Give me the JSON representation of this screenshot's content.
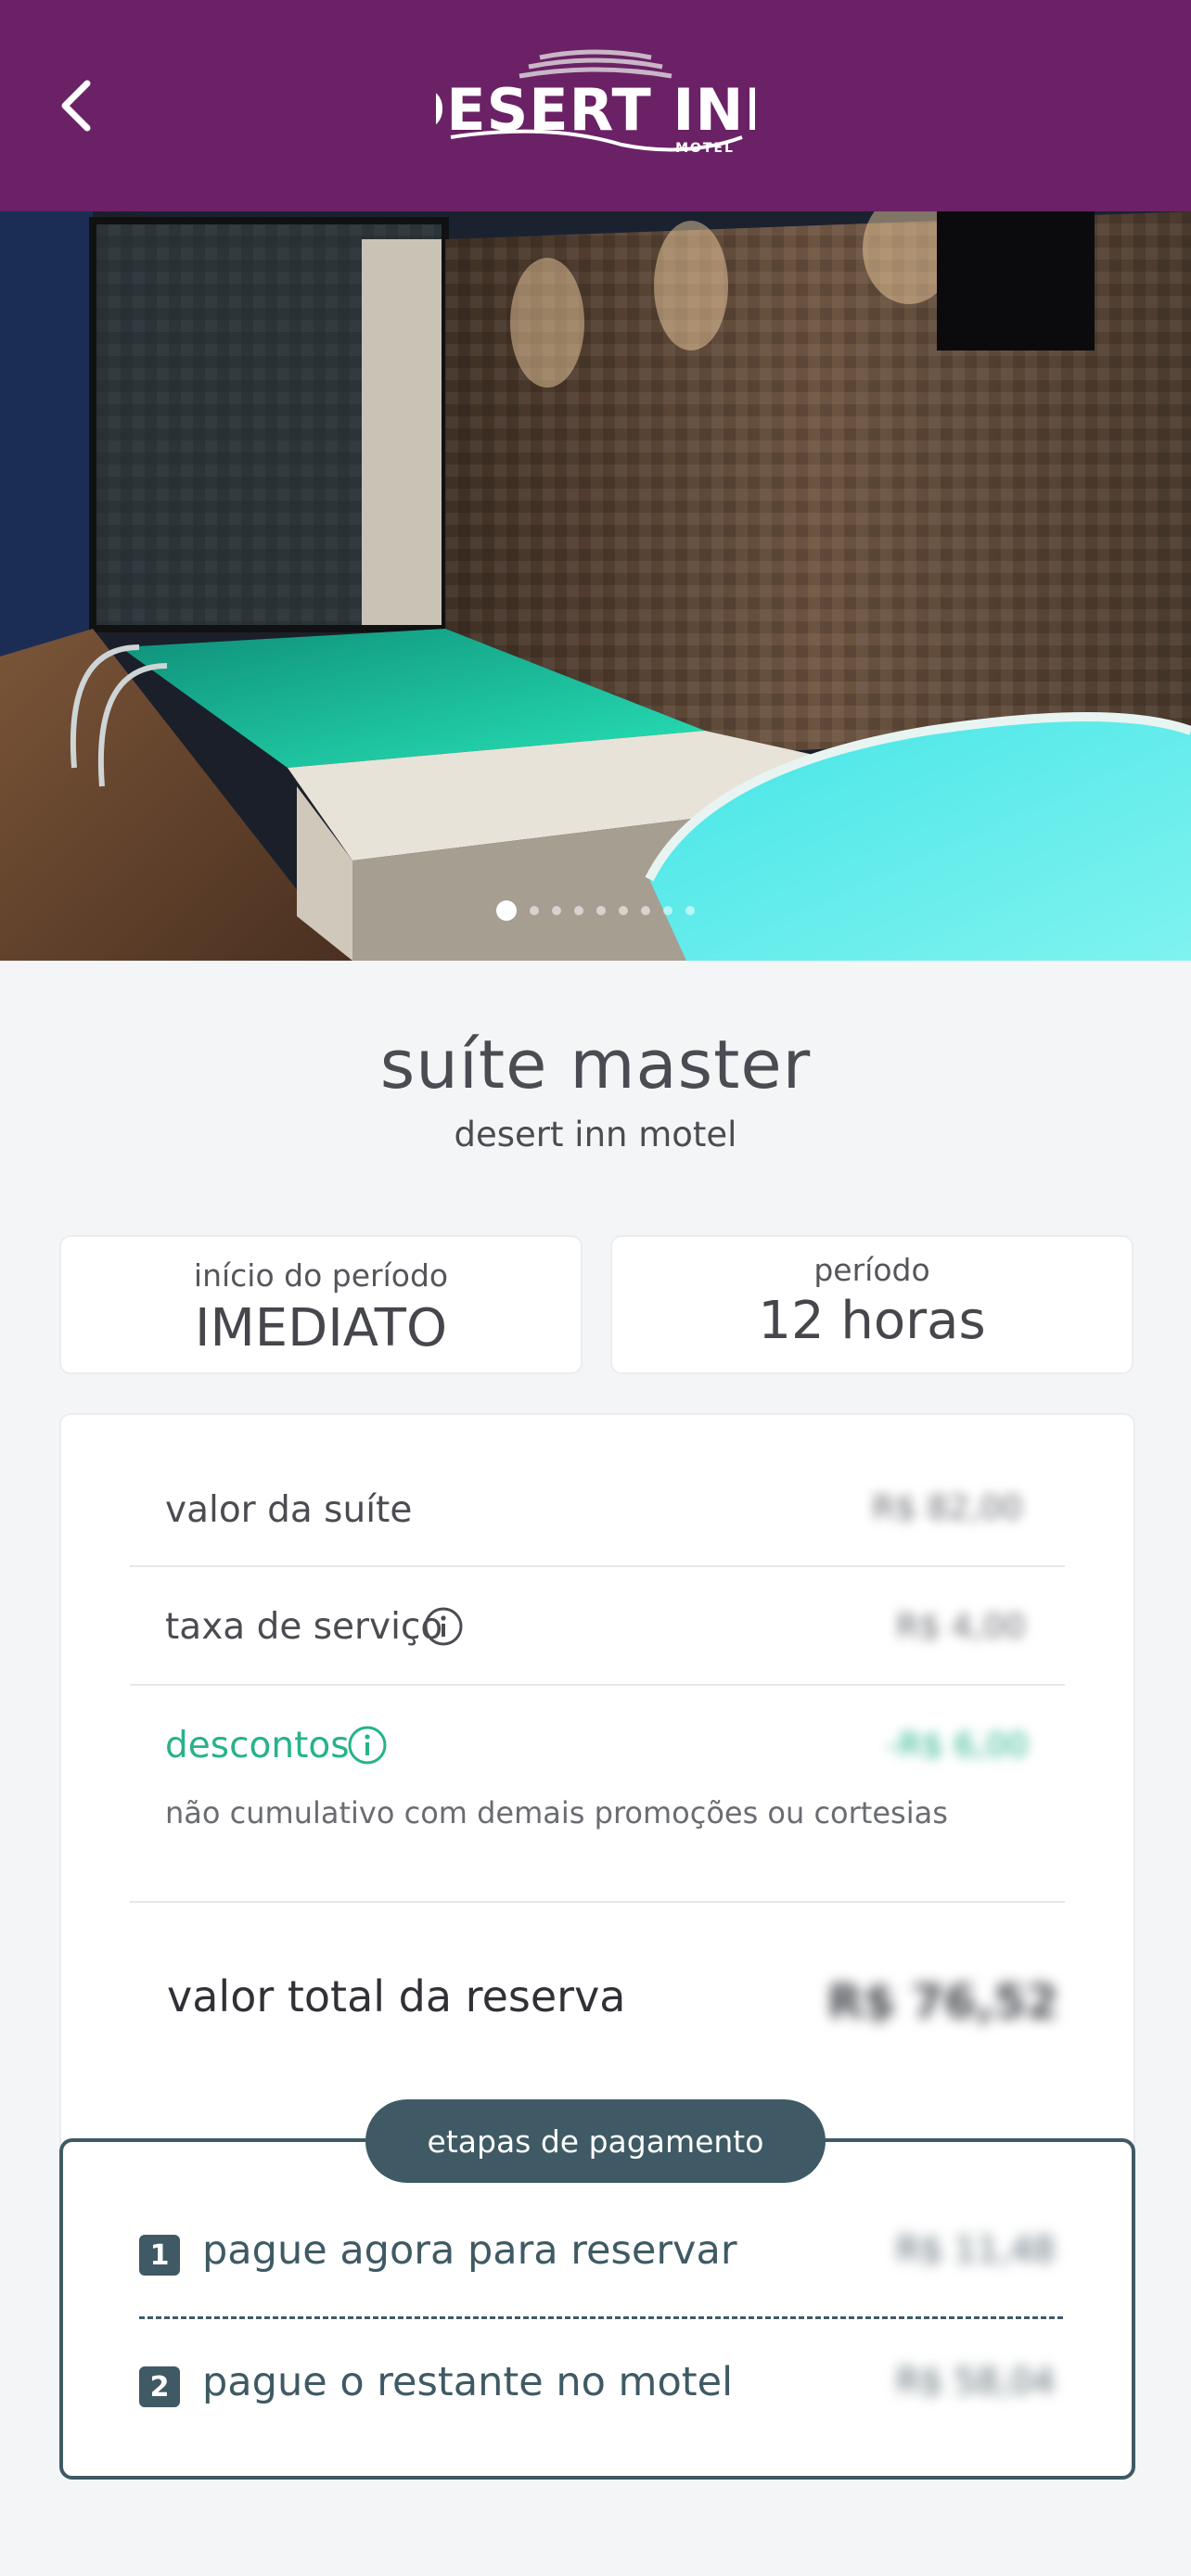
{
  "header": {
    "back_icon": "chevron-left-icon",
    "logo_main": "DESERT INN",
    "logo_sub": "MOTEL",
    "background": "#6b2165"
  },
  "hero": {
    "slide_count": 9,
    "active_slide": 1
  },
  "suite": {
    "title": "suíte master",
    "subtitle": "desert inn motel"
  },
  "period": {
    "start_label": "início do período",
    "start_value": "IMEDIATO",
    "duration_label": "período",
    "duration_value": "12 horas"
  },
  "pricing": {
    "suite_value_label": "valor da suíte",
    "suite_value": "R$ 82,00",
    "service_fee_label": "taxa de serviço",
    "service_fee": "R$ 4,00",
    "discounts_label": "descontos",
    "discounts_value": "-R$ 6,00",
    "discounts_note": "não cumulativo com demais promoções ou cortesias",
    "total_label": "valor total da reserva",
    "total_value": "R$ 76,52"
  },
  "payment_steps": {
    "title": "etapas de pagamento",
    "steps": [
      {
        "number": "1",
        "label": "pague agora para reservar",
        "value": "R$ 11,48"
      },
      {
        "number": "2",
        "label": "pague o restante no motel",
        "value": "R$ 58,04"
      }
    ]
  },
  "colors": {
    "accent_purple": "#6b2165",
    "discount_green": "#27b28a",
    "steps_slate": "#3f5a64"
  }
}
